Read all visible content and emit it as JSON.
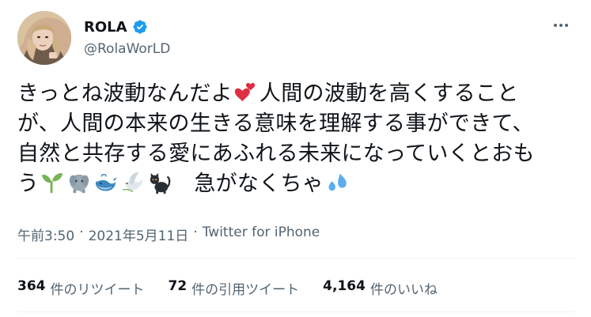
{
  "author": {
    "display_name": "ROLA",
    "handle": "@RolaWorLD",
    "verified": true
  },
  "tweet": {
    "text_parts": [
      "きっとね波動なんだよ",
      "heart-icon",
      "人間の波動を高くすること",
      "が、人間の本来の生きる意味を理解する事ができて、",
      "自然と共存する愛にあふれる未来になっていくとおも",
      "う",
      "seedling-icon",
      "elephant-icon",
      "whale-icon",
      "dove-icon",
      "black-cat-icon",
      "急がなくちゃ",
      "sweat-drops-icon"
    ],
    "line1a": "きっとね波動なんだよ",
    "line1b": "人間の波動を高くすること",
    "line2": "が、人間の本来の生きる意味を理解する事ができて、",
    "line3": "自然と共存する愛にあふれる未来になっていくとおも",
    "line4a": "う",
    "line4b": "急がなくちゃ"
  },
  "meta": {
    "time": "午前3:50",
    "sep1": "·",
    "date": "2021年5月11日",
    "sep2": "·",
    "source": "Twitter for iPhone"
  },
  "stats": {
    "retweets": {
      "num": "364",
      "label": "件のリツイート"
    },
    "quotes": {
      "num": "72",
      "label": "件の引用ツイート"
    },
    "likes": {
      "num": "4,164",
      "label": "件のいいね"
    }
  },
  "colors": {
    "text": "#0f1419",
    "secondary": "#536471",
    "verified": "#1d9bf0",
    "divider": "#eff3f4"
  }
}
